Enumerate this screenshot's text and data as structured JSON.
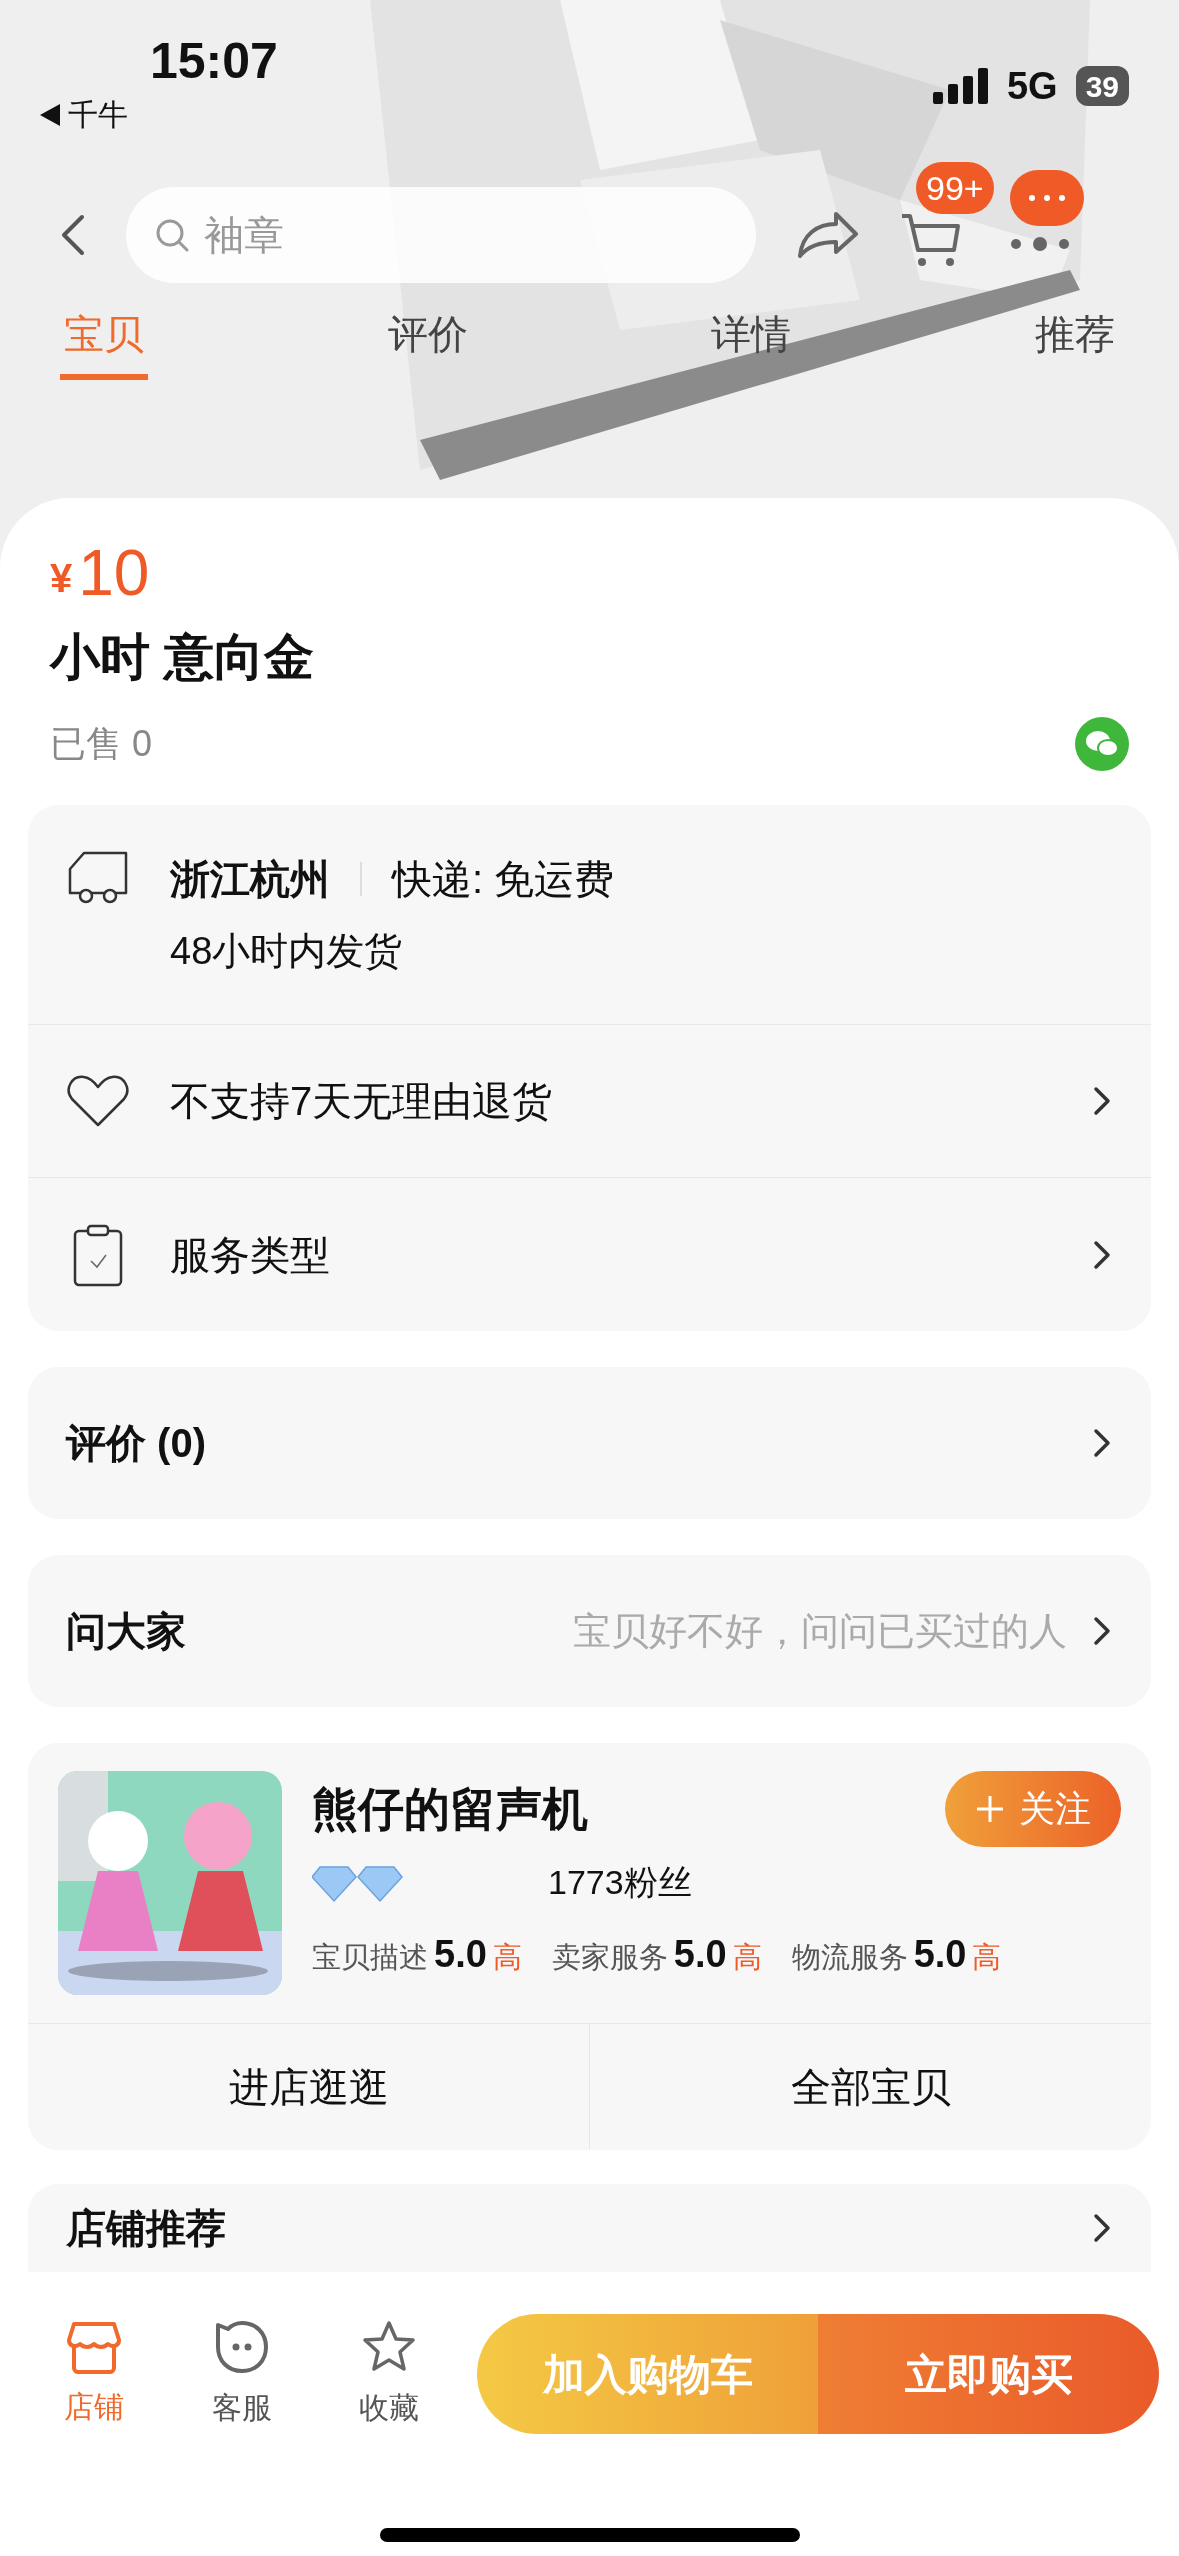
{
  "status_bar": {
    "time": "15:07",
    "back_app": "千牛",
    "network": "5G",
    "battery": "39"
  },
  "nav": {
    "search": {
      "placeholder": "袖章"
    },
    "cart_badge": "99+"
  },
  "tabs": [
    {
      "label": "宝贝",
      "selected": true
    },
    {
      "label": "评价",
      "selected": false
    },
    {
      "label": "详情",
      "selected": false
    },
    {
      "label": "推荐",
      "selected": false
    }
  ],
  "product": {
    "currency": "¥",
    "price": "10",
    "title": "小时 意向金",
    "sold": "已售 0"
  },
  "shipping": {
    "location": "浙江杭州",
    "delivery": "快递: 免运费",
    "dispatch": "48小时内发货"
  },
  "service_rows": [
    {
      "kind": "heart",
      "label": "不支持7天无理由退货"
    },
    {
      "kind": "clipboard",
      "label": "服务类型"
    }
  ],
  "reviews": {
    "title": "评价 (0)"
  },
  "ask": {
    "title": "问大家",
    "hint": "宝贝好不好，问问已买过的人"
  },
  "shop": {
    "name": "熊仔的留声机",
    "fans": "1773粉丝",
    "follow": "关注",
    "ratings": [
      {
        "label": "宝贝描述",
        "score": "5.0",
        "grade": "高"
      },
      {
        "label": "卖家服务",
        "score": "5.0",
        "grade": "高"
      },
      {
        "label": "物流服务",
        "score": "5.0",
        "grade": "高"
      }
    ],
    "buttons": [
      "进店逛逛",
      "全部宝贝"
    ]
  },
  "recommend": {
    "title": "店铺推荐"
  },
  "bottom_bar": {
    "items": [
      {
        "kind": "store",
        "label": "店铺",
        "selected": true
      },
      {
        "kind": "chat",
        "label": "客服",
        "selected": false
      },
      {
        "kind": "star",
        "label": "收藏",
        "selected": false
      }
    ],
    "add_to_cart": "加入购物车",
    "buy_now": "立即购买"
  }
}
